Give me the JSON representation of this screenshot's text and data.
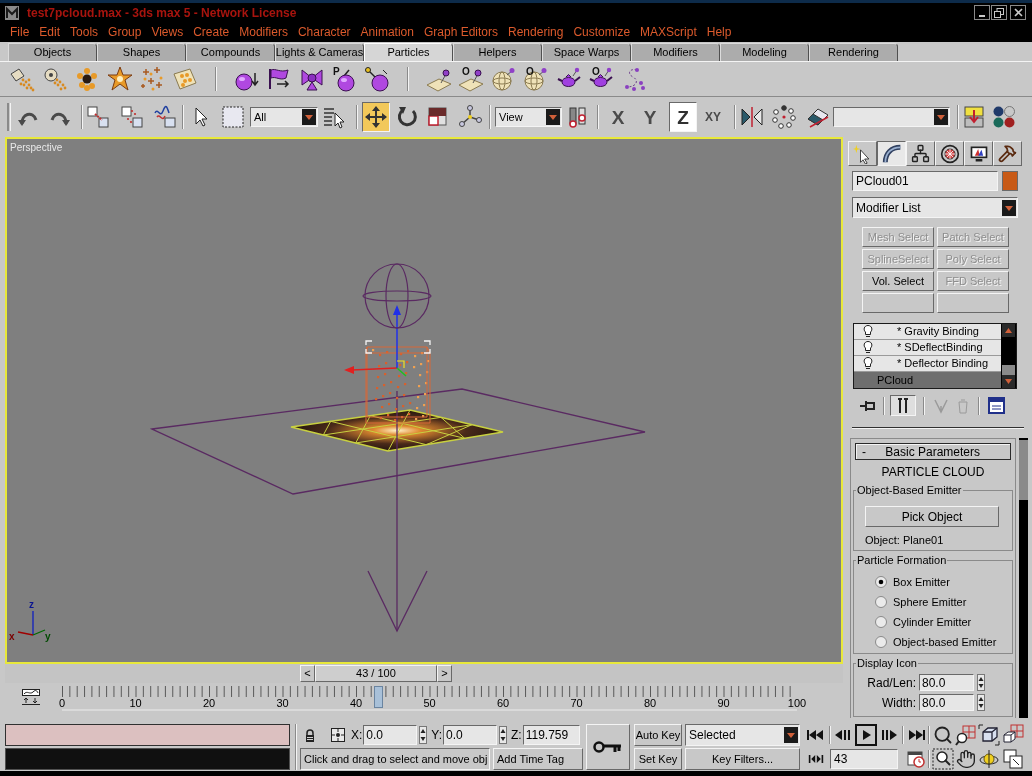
{
  "window": {
    "title": "test7pcloud.max - 3ds max 5 - Network License"
  },
  "menu": [
    "File",
    "Edit",
    "Tools",
    "Group",
    "Views",
    "Create",
    "Modifiers",
    "Character",
    "Animation",
    "Graph Editors",
    "Rendering",
    "Customize",
    "MAXScript",
    "Help"
  ],
  "tabs": [
    {
      "label": "Objects",
      "selected": false
    },
    {
      "label": "Shapes",
      "selected": false
    },
    {
      "label": "Compounds",
      "selected": false
    },
    {
      "label": "Lights & Cameras",
      "selected": false
    },
    {
      "label": "Particles",
      "selected": true
    },
    {
      "label": "Helpers",
      "selected": false
    },
    {
      "label": "Space Warps",
      "selected": false
    },
    {
      "label": "Modifiers",
      "selected": false
    },
    {
      "label": "Modeling",
      "selected": false
    },
    {
      "label": "Rendering",
      "selected": false
    }
  ],
  "create_toolbar": {
    "icon_letters": [
      "P",
      "O",
      "O",
      "O"
    ]
  },
  "main_toolbar": {
    "selection_filter": "All",
    "transform_tools": [
      {
        "selected": true
      },
      {
        "selected": false
      },
      {
        "selected": false
      }
    ],
    "coordinate_system": "View",
    "axis_constraints": [
      {
        "label": "X",
        "selected": false
      },
      {
        "label": "Y",
        "selected": false
      },
      {
        "label": "Z",
        "selected": true
      },
      {
        "label": "XY",
        "selected": false
      }
    ]
  },
  "viewport": {
    "label": "Perspective",
    "active": true,
    "axis_labels": [
      "z",
      "x",
      "y"
    ]
  },
  "time_slider": {
    "prev": "<",
    "reading": "43 / 100",
    "next": ">",
    "level": 0.43
  },
  "track_bar": {
    "labels": [
      "0",
      "10",
      "20",
      "30",
      "40",
      "50",
      "60",
      "70",
      "80",
      "90",
      "100"
    ],
    "level": 0.43
  },
  "command_panel": {
    "tabs": [
      {
        "selected": false
      },
      {
        "selected": true
      },
      {
        "selected": false
      },
      {
        "selected": false
      },
      {
        "selected": false
      },
      {
        "selected": false
      }
    ],
    "object_name": "PCloud01",
    "modifier_list": "Modifier List",
    "modifier_buttons": [
      {
        "label": "Mesh Select",
        "disabled": true
      },
      {
        "label": "Patch Select",
        "disabled": true
      },
      {
        "label": "SplineSelect",
        "disabled": true
      },
      {
        "label": "Poly Select",
        "disabled": true
      },
      {
        "label": "Vol. Select",
        "disabled": false
      },
      {
        "label": "FFD Select",
        "disabled": true
      }
    ],
    "stack": [
      {
        "kind": "modifier",
        "label": "* Gravity Binding",
        "selected": false
      },
      {
        "kind": "modifier",
        "label": "* SDeflectBinding",
        "selected": false
      },
      {
        "kind": "modifier",
        "label": "* Deflector Binding",
        "selected": false
      },
      {
        "kind": "base",
        "label": "PCloud",
        "selected": true
      }
    ],
    "show_end_result": true,
    "rollout": {
      "toggle": "-",
      "title": "Basic Parameters",
      "heading": "PARTICLE CLOUD",
      "groups": [
        {
          "kind": "emitter",
          "title": "Object-Based Emitter",
          "button": "Pick Object",
          "info": "Object: Plane01"
        },
        {
          "kind": "radio",
          "title": "Particle Formation",
          "options": [
            {
              "label": "Box Emitter",
              "selected": true
            },
            {
              "label": "Sphere Emitter",
              "selected": false
            },
            {
              "label": "Cylinder Emitter",
              "selected": false
            },
            {
              "label": "Object-based Emitter",
              "selected": false
            }
          ]
        },
        {
          "kind": "fields",
          "title": "Display Icon",
          "fields": [
            {
              "label": "Rad/Len:",
              "value": "80.0"
            },
            {
              "label": "Width:",
              "value": "80.0"
            }
          ]
        }
      ]
    }
  },
  "status_bar": {
    "coordinates": [
      {
        "label": "X:",
        "value": "0.0"
      },
      {
        "label": "Y:",
        "value": "0.0"
      },
      {
        "label": "Z:",
        "value": "119.759"
      }
    ],
    "prompt": "Click and drag to select and move obj",
    "time_tag": "Add Time Tag",
    "auto_key": "Auto Key",
    "set_key": "Set Key",
    "key_set": "Selected",
    "key_filters": "Key Filters...",
    "current_frame": "43"
  }
}
